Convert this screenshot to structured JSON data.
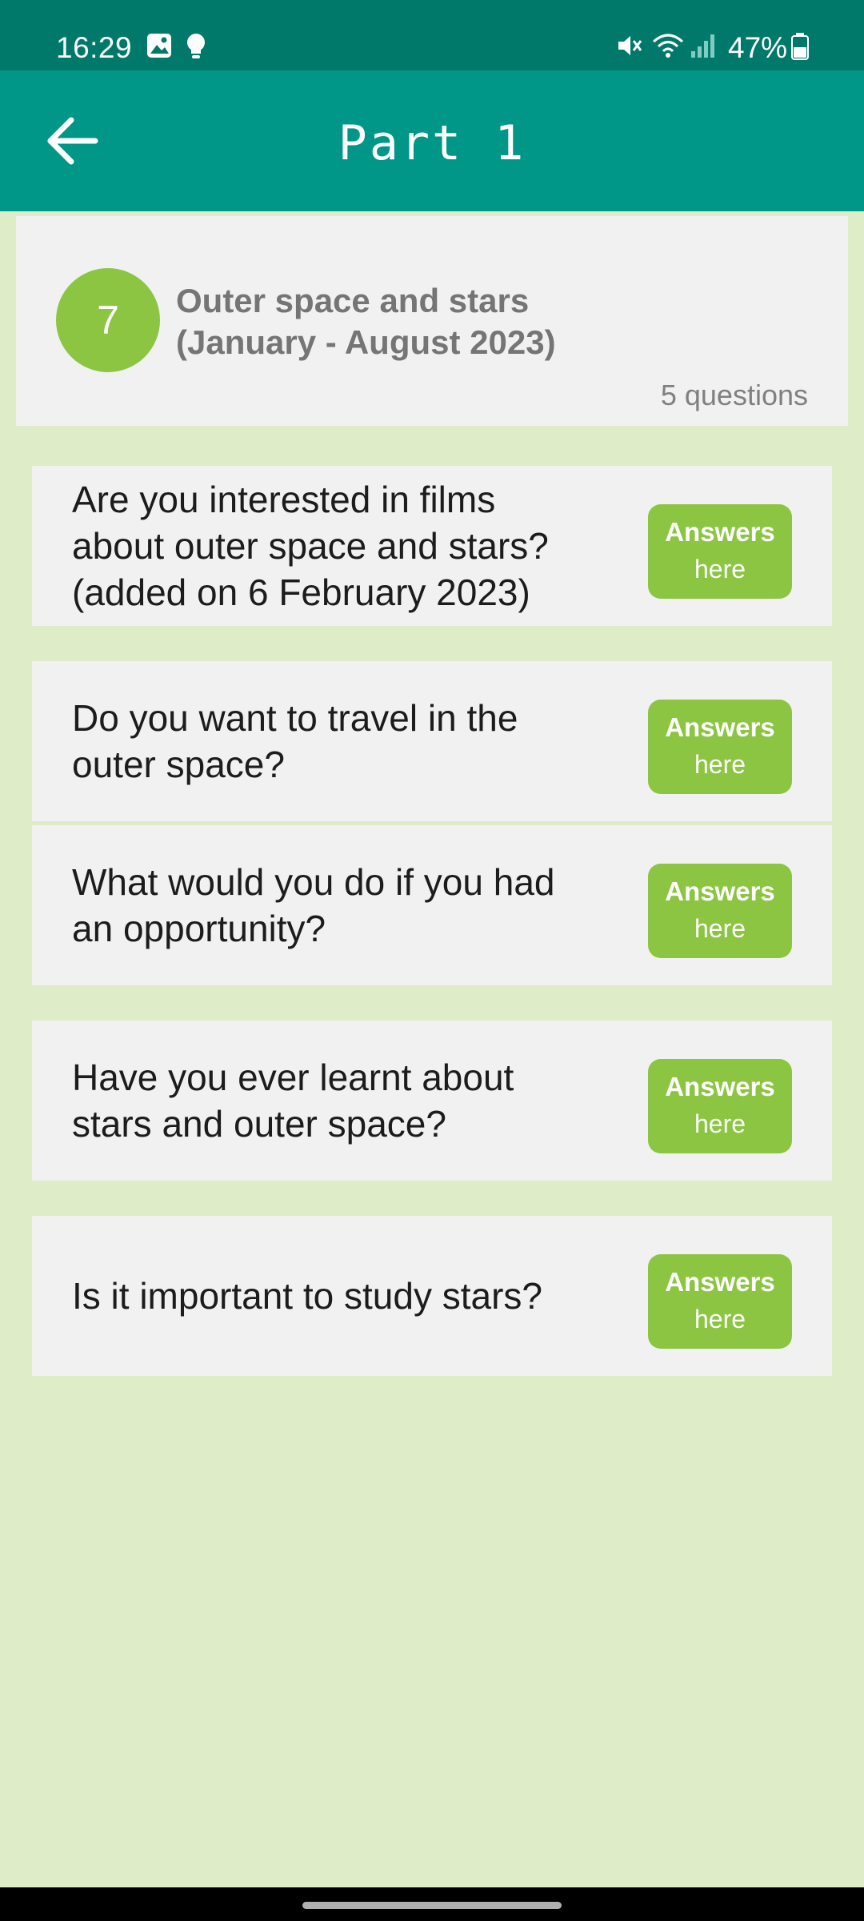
{
  "status_bar": {
    "time": "16:29",
    "battery": "47%",
    "icons": [
      "gallery-icon",
      "bulb-icon",
      "mute-icon",
      "wifi-icon",
      "signal-icon",
      "battery-icon"
    ]
  },
  "app_bar": {
    "title": "Part 1",
    "back_icon": "arrow-left-icon"
  },
  "topic": {
    "number": "7",
    "title": "Outer space and stars\n(January - August 2023)",
    "count": "5 questions"
  },
  "questions": [
    {
      "text": "Are you interested in films\nabout outer space and stars?\n(added on 6 February 2023)",
      "button_line1": "Answers",
      "button_line2": "here"
    },
    {
      "text": "Do you want to travel in the\nouter space?",
      "button_line1": "Answers",
      "button_line2": "here"
    },
    {
      "text": "What would you do if you had\nan opportunity?",
      "button_line1": "Answers",
      "button_line2": "here"
    },
    {
      "text": "Have you ever learnt about\nstars and outer space?",
      "button_line1": "Answers",
      "button_line2": "here"
    },
    {
      "text": "Is it important to study stars?",
      "button_line1": "Answers",
      "button_line2": "here"
    }
  ],
  "colors": {
    "status_bar": "#00796b",
    "app_bar": "#009688",
    "accent_green": "#8bc541",
    "page_background": "#dfecc8",
    "card": "#f1f1f1"
  }
}
